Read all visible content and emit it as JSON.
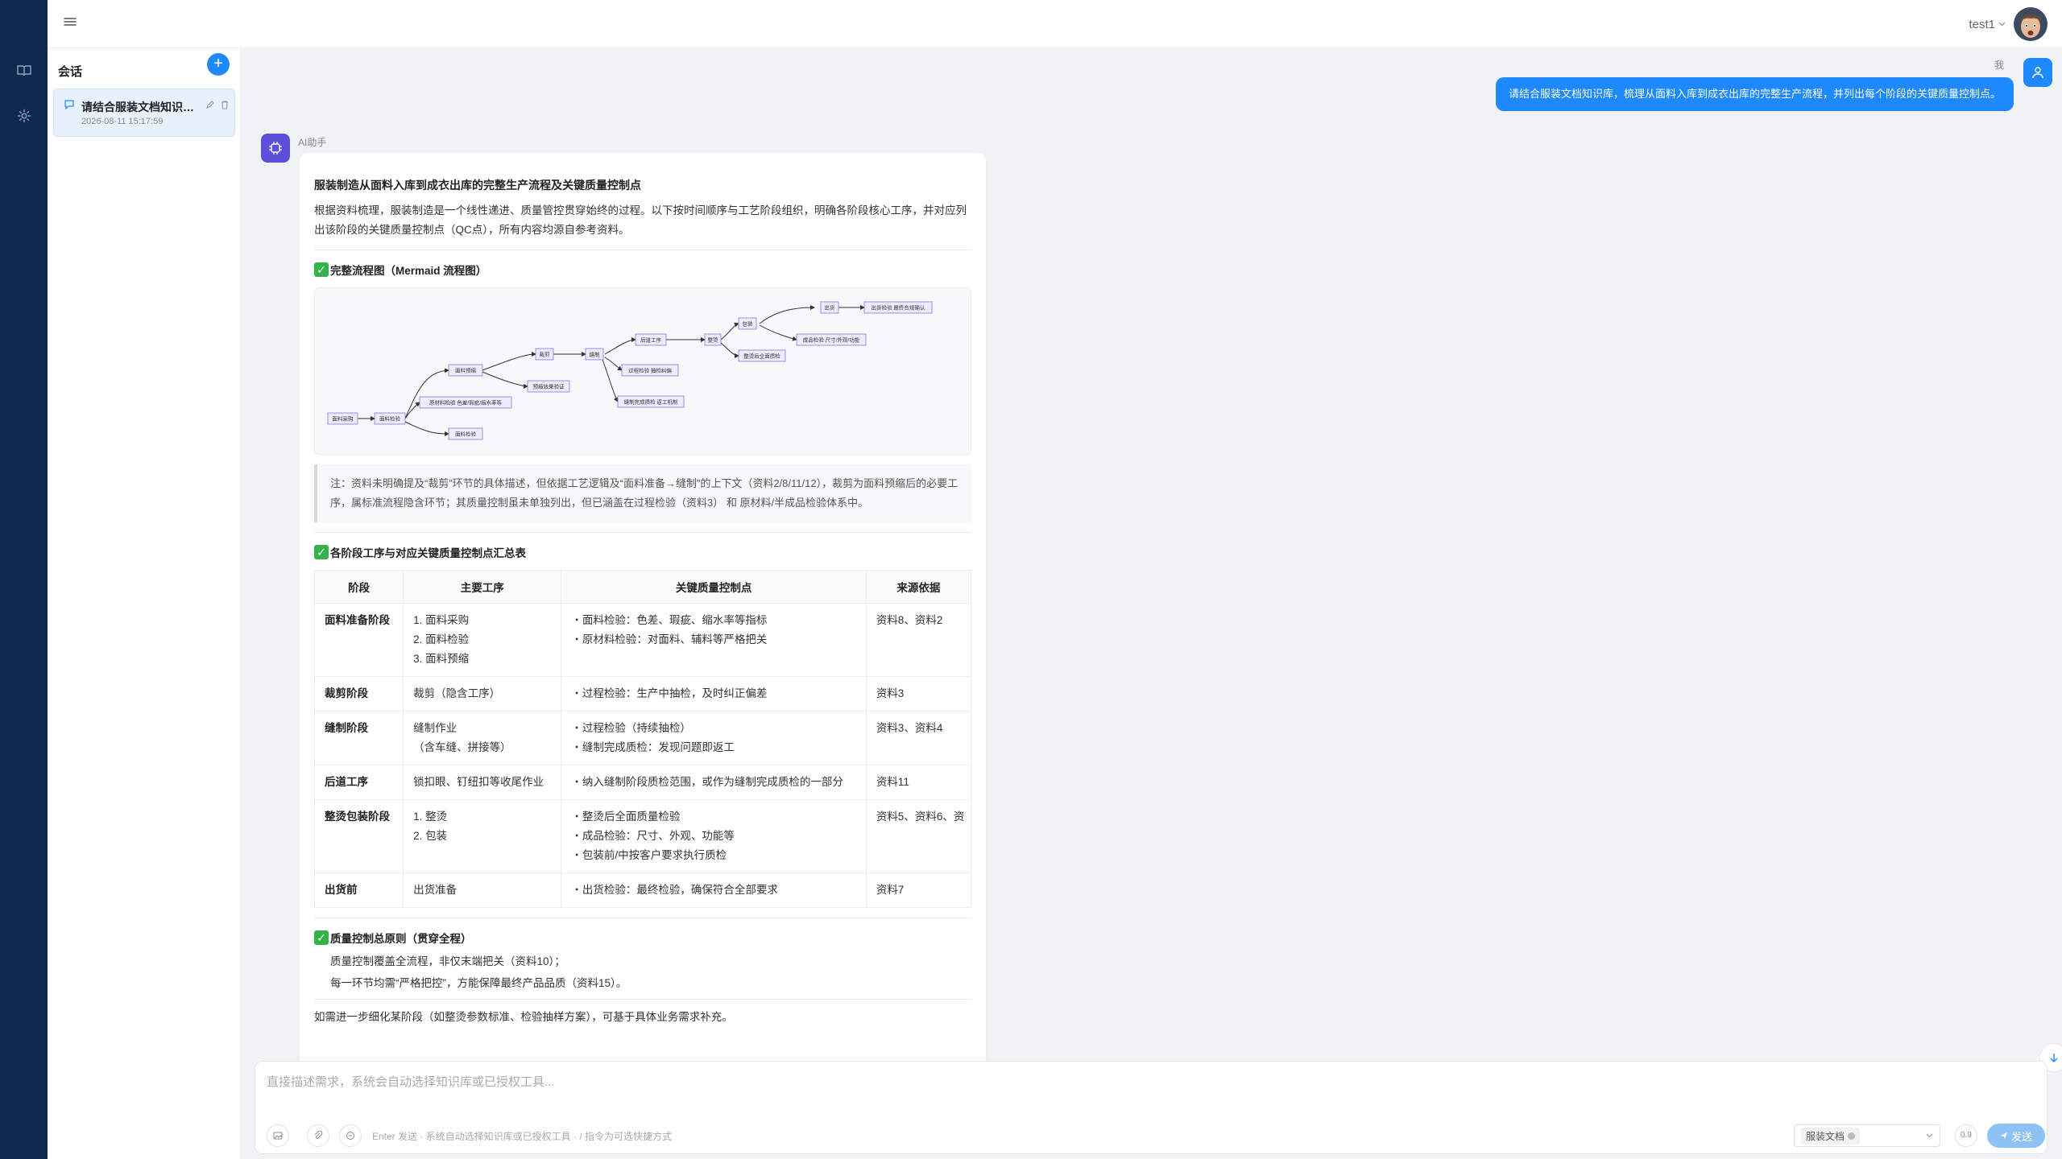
{
  "topbar": {
    "username": "test1"
  },
  "sidebar": {
    "title": "会话",
    "conversations": [
      {
        "title": "请结合服装文档知识库，梳理从面料入库到成衣出库的完整生产流程，并列出每个阶段的关键质量控制点。",
        "time": "2026-08-11 15:17:59"
      }
    ]
  },
  "chat": {
    "user_label": "我",
    "user_message": "请结合服装文档知识库，梳理从面料入库到成衣出库的完整生产流程，并列出每个阶段的关键质量控制点。",
    "ai_label": "AI助手",
    "answer": {
      "title": "服装制造从面料入库到成衣出库的完整生产流程及关键质量控制点",
      "intro": "根据资料梳理，服装制造是一个线性递进、质量管控贯穿始终的过程。以下按时间顺序与工艺阶段组织，明确各阶段核心工序，并对应列出该阶段的关键质量控制点（QC点），所有内容均源自参考资料。",
      "flow_heading": "完整流程图（Mermaid 流程图）",
      "flow_nodes": {
        "n1": "面料采购",
        "n2": "面料检验",
        "n3": "面料预缩",
        "n4": "原材料检验 色差/瑕疵/缩水率等",
        "n5": "面料检验",
        "n6": "裁剪",
        "n7": "预缩效果验证",
        "n8": "缝制",
        "n9": "后道工序",
        "n10": "过程检验 抽检纠偏",
        "n11": "缝制完成质检 返工机制",
        "n12": "整烫",
        "n13": "包装",
        "n14": "整烫后全面质检",
        "n15": "出货",
        "n16": "成品检验 尺寸/外观/功能",
        "n17": "出货检验 最终合规确认"
      },
      "note": "注：资料未明确提及“裁剪”环节的具体描述，但依据工艺逻辑及“面料准备→缝制”的上下文（资料2/8/11/12），裁剪为面料预缩后的必要工序，属标准流程隐含环节；其质量控制虽未单独列出，但已涵盖在过程检验（资料3） 和 原材料/半成品检验体系中。",
      "table_heading": "各阶段工序与对应关键质量控制点汇总表",
      "table": {
        "headers": [
          "阶段",
          "主要工序",
          "关键质量控制点",
          "来源依据"
        ],
        "rows": [
          {
            "stage": "面料准备阶段",
            "process": [
              "1. 面料采购",
              "2. 面料检验",
              "3. 面料预缩"
            ],
            "qc": [
              "・面料检验：色差、瑕疵、缩水率等指标",
              "・原材料检验：对面料、辅料等严格把关"
            ],
            "source": "资料8、资料2"
          },
          {
            "stage": "裁剪阶段",
            "process": [
              "裁剪（隐含工序）"
            ],
            "qc": [
              "・过程检验：生产中抽检，及时纠正偏差"
            ],
            "source": "资料3"
          },
          {
            "stage": "缝制阶段",
            "process": [
              "缝制作业",
              "（含车缝、拼接等）"
            ],
            "qc": [
              "・过程检验（持续抽检）",
              "・缝制完成质检：发现问题即返工"
            ],
            "source": "资料3、资料4"
          },
          {
            "stage": "后道工序",
            "process": [
              "锁扣眼、钉纽扣等收尾作业"
            ],
            "qc": [
              "・纳入缝制阶段质检范围，或作为缝制完成质检的一部分"
            ],
            "source": "资料11"
          },
          {
            "stage": "整烫包装阶段",
            "process": [
              "1. 整烫",
              "2. 包装"
            ],
            "qc": [
              "・整烫后全面质量检验",
              "・成品检验：尺寸、外观、功能等",
              "・包装前/中按客户要求执行质检"
            ],
            "source": "资料5、资料6、资"
          },
          {
            "stage": "出货前",
            "process": [
              "出货准备"
            ],
            "qc": [
              "・出货检验：最终检验，确保符合全部要求"
            ],
            "source": "资料7"
          }
        ]
      },
      "principle_heading": "质量控制总原则（贯穿全程）",
      "principles": [
        "质量控制覆盖全流程，非仅末端把关（资料10）；",
        "每一环节均需“严格把控”，方能保障最终产品品质（资料15）。"
      ],
      "closing": "如需进一步细化某阶段（如整烫参数标准、检验抽样方案），可基于具体业务需求补充。"
    }
  },
  "composer": {
    "placeholder": "直接描述需求，系统会自动选择知识库或已授权工具...",
    "hint": "Enter 发送 · 系统自动选择知识库或已授权工具 · / 指令为可选快捷方式",
    "kb_tag": "服装文档",
    "temperature": "0.9",
    "send_label": "发送"
  },
  "colors": {
    "primary": "#1e88ff",
    "rail": "#0e2a4f",
    "ai_avatar": "#5c51d6",
    "check": "#35b34a"
  }
}
